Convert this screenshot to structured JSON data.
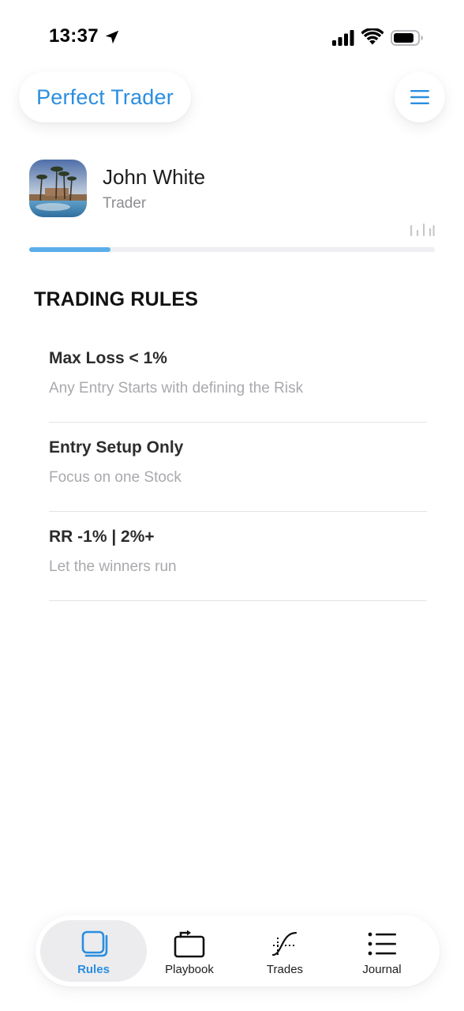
{
  "status_bar": {
    "time": "13:37"
  },
  "header": {
    "brand_title": "Perfect Trader",
    "menu_icon": "hamburger-menu-icon"
  },
  "profile": {
    "name": "John White",
    "role": "Trader",
    "progress_fraction": 0.2
  },
  "rules_section": {
    "title": "TRADING RULES",
    "items": [
      {
        "title": "Max Loss < 1%",
        "description": "Any Entry Starts with defining the Risk"
      },
      {
        "title": "Entry Setup Only",
        "description": "Focus on one Stock"
      },
      {
        "title": "RR -1% | 2%+",
        "description": "Let the winners run"
      }
    ]
  },
  "tab_bar": {
    "tabs": [
      {
        "label": "Rules",
        "icon": "rules-icon",
        "active": true
      },
      {
        "label": "Playbook",
        "icon": "playbook-icon",
        "active": false
      },
      {
        "label": "Trades",
        "icon": "trades-icon",
        "active": false
      },
      {
        "label": "Journal",
        "icon": "journal-icon",
        "active": false
      }
    ]
  },
  "colors": {
    "accent": "#2a8ee0",
    "progress": "#5aaeea",
    "active_tab_bg": "#ececee"
  }
}
